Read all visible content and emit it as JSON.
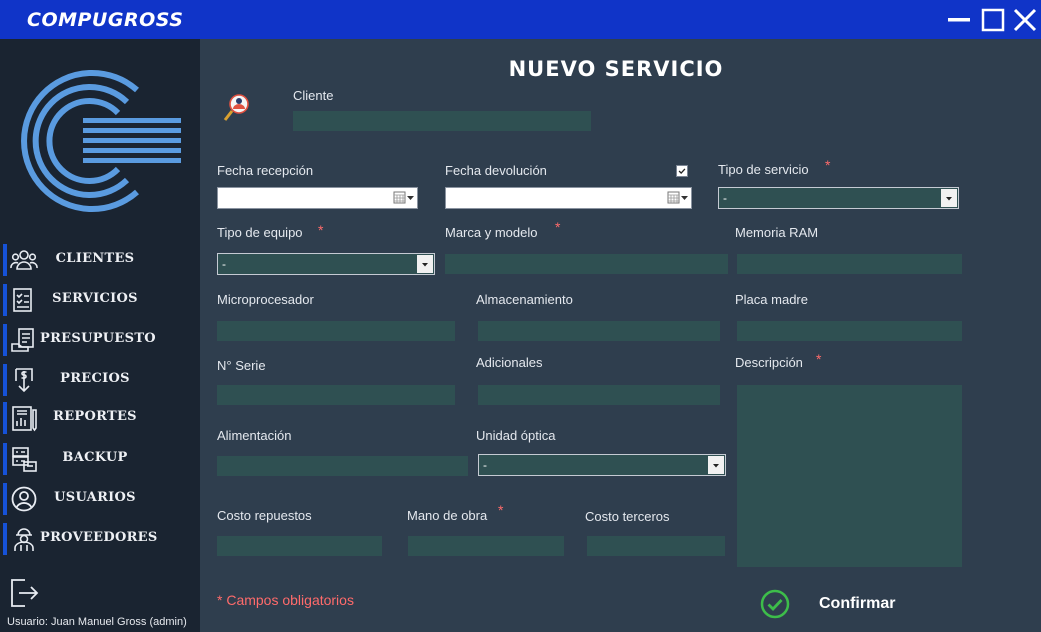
{
  "app": {
    "title": "COMPUGROSS"
  },
  "sidebar": {
    "items": [
      {
        "label": "CLIENTES",
        "icon": "users-icon"
      },
      {
        "label": "SERVICIOS",
        "icon": "checklist-icon"
      },
      {
        "label": "PRESUPUESTO",
        "icon": "budget-icon"
      },
      {
        "label": "PRECIOS",
        "icon": "price-icon"
      },
      {
        "label": "REPORTES",
        "icon": "report-icon"
      },
      {
        "label": "BACKUP",
        "icon": "backup-icon"
      },
      {
        "label": "USUARIOS",
        "icon": "user-icon"
      },
      {
        "label": "PROVEEDORES",
        "icon": "supplier-icon"
      }
    ],
    "user_label": "Usuario: Juan Manuel Gross (admin)"
  },
  "form": {
    "title": "NUEVO SERVICIO",
    "cliente_label": "Cliente",
    "fecha_recepcion_label": "Fecha recepción",
    "fecha_devolucion_label": "Fecha devolución",
    "fecha_devolucion_checked": true,
    "tipo_servicio_label": "Tipo de  servicio",
    "tipo_servicio_value": "-",
    "tipo_equipo_label": "Tipo de equipo",
    "tipo_equipo_value": "-",
    "marca_modelo_label": "Marca y modelo",
    "memoria_label": "Memoria RAM",
    "micro_label": "Microprocesador",
    "almacenamiento_label": "Almacenamiento",
    "placa_label": "Placa madre",
    "serie_label": "N° Serie",
    "adicionales_label": "Adicionales",
    "descripcion_label": "Descripción",
    "alimentacion_label": "Alimentación",
    "unidad_optica_label": "Unidad óptica",
    "unidad_optica_value": "-",
    "costo_repuestos_label": "Costo repuestos",
    "mano_obra_label": "Mano de obra",
    "costo_terceros_label": "Costo terceros",
    "required_mark": "*",
    "mandatory_note": "* Campos obligatorios",
    "confirm_label": "Confirmar"
  },
  "colors": {
    "titlebar": "#1034c8",
    "sidebar": "#1a2431",
    "main": "#2f3e4e",
    "field": "#2f5052",
    "accent": "#1652d8",
    "required": "#ff6b6b",
    "confirm": "#3dbd4a"
  }
}
